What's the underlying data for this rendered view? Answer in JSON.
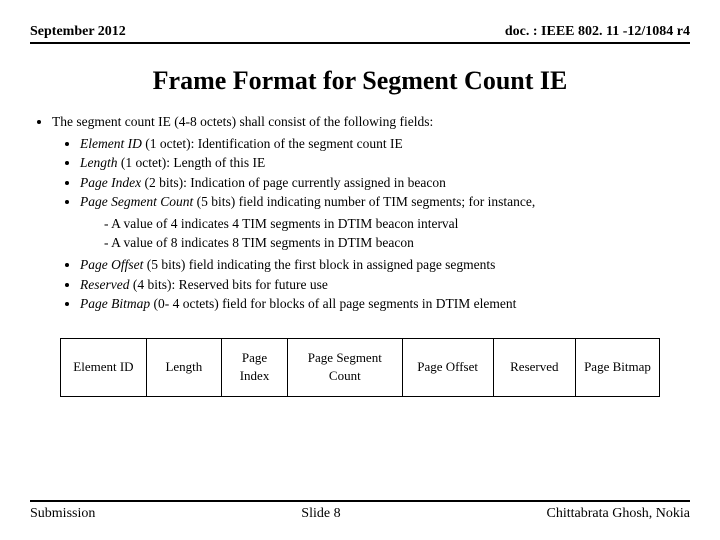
{
  "header": {
    "left": "September 2012",
    "right": "doc. : IEEE 802. 11 -12/1084 r4"
  },
  "title": "Frame Format for Segment Count IE",
  "intro": "The segment count IE (4-8 octets) shall consist of the following fields:",
  "fields": {
    "f1_name": "Element ID",
    "f1_desc": " (1 octet): Identification of the segment count IE",
    "f2_name": "Length",
    "f2_desc": " (1 octet): Length of this IE",
    "f3_name": "Page Index",
    "f3_desc": " (2 bits): Indication of page currently assigned in beacon",
    "f4_name": "Page Segment Count",
    "f4_desc": " (5 bits) field indicating number of TIM segments; for instance,",
    "f4_sub1": "A value of 4 indicates 4 TIM segments in DTIM beacon interval",
    "f4_sub2": "A value of 8 indicates 8 TIM segments in DTIM beacon",
    "f5_name": "Page Offset",
    "f5_desc": " (5 bits) field indicating the first block in assigned page segments",
    "f6_name": "Reserved",
    "f6_desc": " (4 bits): Reserved bits for future use",
    "f7_name": "Page Bitmap",
    "f7_desc": " (0- 4 octets) field for blocks of all page segments in DTIM element"
  },
  "diagram": {
    "c1": "Element ID",
    "c2": "Length",
    "c3": "Page Index",
    "c4": "Page Segment Count",
    "c5": "Page Offset",
    "c6": "Reserved",
    "c7": "Page Bitmap"
  },
  "footer": {
    "left": "Submission",
    "center": "Slide 8",
    "right": "Chittabrata Ghosh, Nokia"
  }
}
